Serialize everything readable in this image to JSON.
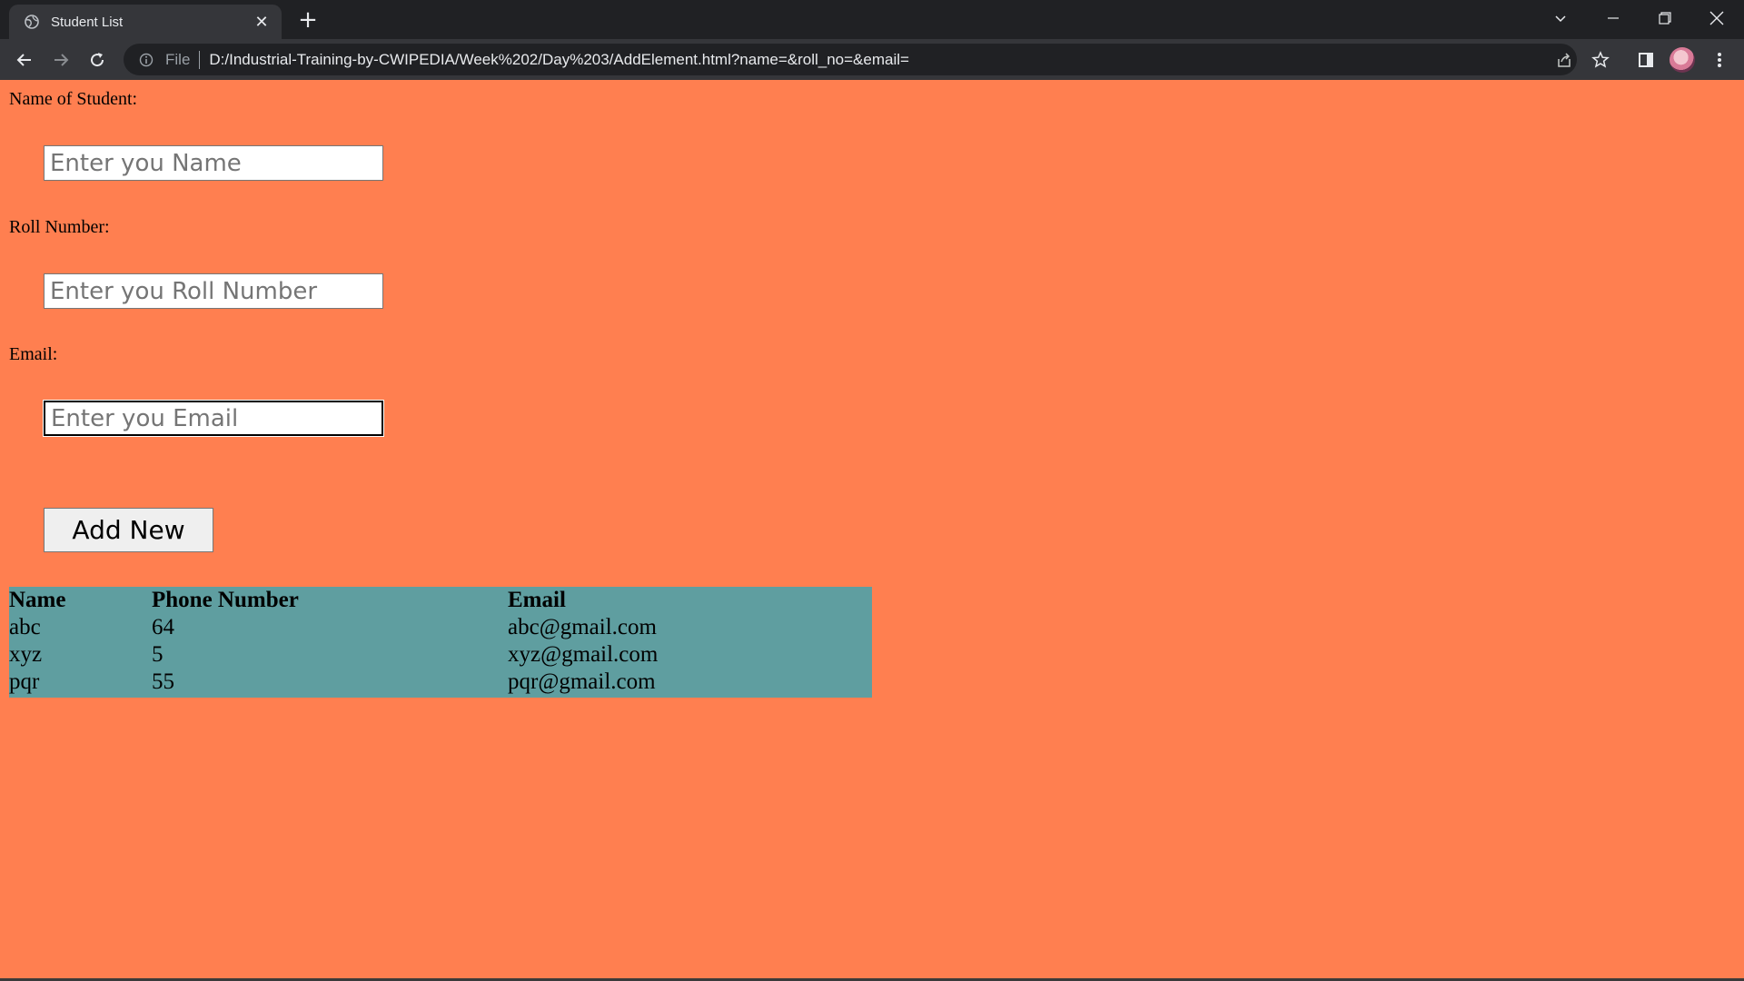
{
  "browser": {
    "tab_title": "Student List",
    "tab_close": "✕",
    "new_tab": "+",
    "scheme_label": "File",
    "url": "D:/Industrial-Training-by-CWIPEDIA/Week%202/Day%203/AddElement.html?name=&roll_no=&email="
  },
  "form": {
    "name_label": "Name of Student:",
    "name_placeholder": "Enter you Name",
    "roll_label": "Roll Number:",
    "roll_placeholder": "Enter you Roll Number",
    "email_label": "Email:",
    "email_placeholder": "Enter you Email",
    "add_button": "Add New"
  },
  "table": {
    "headers": [
      "Name",
      "Phone Number",
      "Email"
    ],
    "rows": [
      [
        "abc",
        "64",
        "abc@gmail.com"
      ],
      [
        "xyz",
        "5",
        "xyz@gmail.com"
      ],
      [
        "pqr",
        "55",
        "pqr@gmail.com"
      ]
    ]
  },
  "colors": {
    "page_background": "#ff7f50",
    "table_background": "#5f9ea0"
  }
}
